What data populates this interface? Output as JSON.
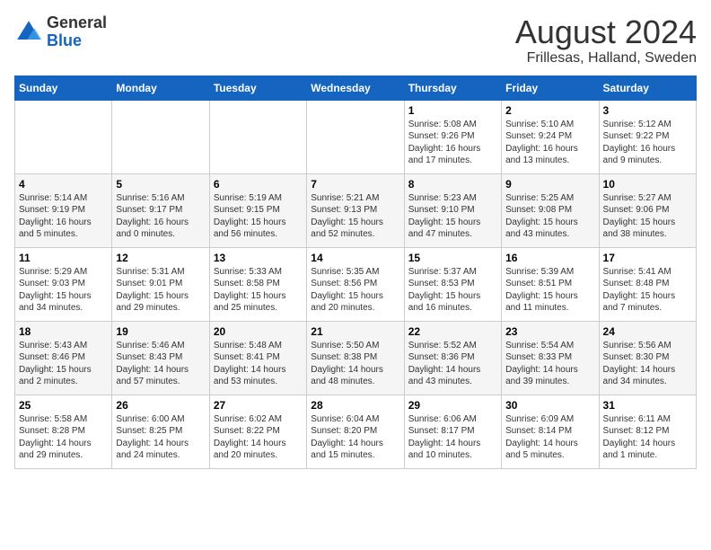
{
  "header": {
    "logo_general": "General",
    "logo_blue": "Blue",
    "month_year": "August 2024",
    "location": "Frillesas, Halland, Sweden"
  },
  "weekdays": [
    "Sunday",
    "Monday",
    "Tuesday",
    "Wednesday",
    "Thursday",
    "Friday",
    "Saturday"
  ],
  "weeks": [
    [
      {
        "day": "",
        "info": ""
      },
      {
        "day": "",
        "info": ""
      },
      {
        "day": "",
        "info": ""
      },
      {
        "day": "",
        "info": ""
      },
      {
        "day": "1",
        "info": "Sunrise: 5:08 AM\nSunset: 9:26 PM\nDaylight: 16 hours\nand 17 minutes."
      },
      {
        "day": "2",
        "info": "Sunrise: 5:10 AM\nSunset: 9:24 PM\nDaylight: 16 hours\nand 13 minutes."
      },
      {
        "day": "3",
        "info": "Sunrise: 5:12 AM\nSunset: 9:22 PM\nDaylight: 16 hours\nand 9 minutes."
      }
    ],
    [
      {
        "day": "4",
        "info": "Sunrise: 5:14 AM\nSunset: 9:19 PM\nDaylight: 16 hours\nand 5 minutes."
      },
      {
        "day": "5",
        "info": "Sunrise: 5:16 AM\nSunset: 9:17 PM\nDaylight: 16 hours\nand 0 minutes."
      },
      {
        "day": "6",
        "info": "Sunrise: 5:19 AM\nSunset: 9:15 PM\nDaylight: 15 hours\nand 56 minutes."
      },
      {
        "day": "7",
        "info": "Sunrise: 5:21 AM\nSunset: 9:13 PM\nDaylight: 15 hours\nand 52 minutes."
      },
      {
        "day": "8",
        "info": "Sunrise: 5:23 AM\nSunset: 9:10 PM\nDaylight: 15 hours\nand 47 minutes."
      },
      {
        "day": "9",
        "info": "Sunrise: 5:25 AM\nSunset: 9:08 PM\nDaylight: 15 hours\nand 43 minutes."
      },
      {
        "day": "10",
        "info": "Sunrise: 5:27 AM\nSunset: 9:06 PM\nDaylight: 15 hours\nand 38 minutes."
      }
    ],
    [
      {
        "day": "11",
        "info": "Sunrise: 5:29 AM\nSunset: 9:03 PM\nDaylight: 15 hours\nand 34 minutes."
      },
      {
        "day": "12",
        "info": "Sunrise: 5:31 AM\nSunset: 9:01 PM\nDaylight: 15 hours\nand 29 minutes."
      },
      {
        "day": "13",
        "info": "Sunrise: 5:33 AM\nSunset: 8:58 PM\nDaylight: 15 hours\nand 25 minutes."
      },
      {
        "day": "14",
        "info": "Sunrise: 5:35 AM\nSunset: 8:56 PM\nDaylight: 15 hours\nand 20 minutes."
      },
      {
        "day": "15",
        "info": "Sunrise: 5:37 AM\nSunset: 8:53 PM\nDaylight: 15 hours\nand 16 minutes."
      },
      {
        "day": "16",
        "info": "Sunrise: 5:39 AM\nSunset: 8:51 PM\nDaylight: 15 hours\nand 11 minutes."
      },
      {
        "day": "17",
        "info": "Sunrise: 5:41 AM\nSunset: 8:48 PM\nDaylight: 15 hours\nand 7 minutes."
      }
    ],
    [
      {
        "day": "18",
        "info": "Sunrise: 5:43 AM\nSunset: 8:46 PM\nDaylight: 15 hours\nand 2 minutes."
      },
      {
        "day": "19",
        "info": "Sunrise: 5:46 AM\nSunset: 8:43 PM\nDaylight: 14 hours\nand 57 minutes."
      },
      {
        "day": "20",
        "info": "Sunrise: 5:48 AM\nSunset: 8:41 PM\nDaylight: 14 hours\nand 53 minutes."
      },
      {
        "day": "21",
        "info": "Sunrise: 5:50 AM\nSunset: 8:38 PM\nDaylight: 14 hours\nand 48 minutes."
      },
      {
        "day": "22",
        "info": "Sunrise: 5:52 AM\nSunset: 8:36 PM\nDaylight: 14 hours\nand 43 minutes."
      },
      {
        "day": "23",
        "info": "Sunrise: 5:54 AM\nSunset: 8:33 PM\nDaylight: 14 hours\nand 39 minutes."
      },
      {
        "day": "24",
        "info": "Sunrise: 5:56 AM\nSunset: 8:30 PM\nDaylight: 14 hours\nand 34 minutes."
      }
    ],
    [
      {
        "day": "25",
        "info": "Sunrise: 5:58 AM\nSunset: 8:28 PM\nDaylight: 14 hours\nand 29 minutes."
      },
      {
        "day": "26",
        "info": "Sunrise: 6:00 AM\nSunset: 8:25 PM\nDaylight: 14 hours\nand 24 minutes."
      },
      {
        "day": "27",
        "info": "Sunrise: 6:02 AM\nSunset: 8:22 PM\nDaylight: 14 hours\nand 20 minutes."
      },
      {
        "day": "28",
        "info": "Sunrise: 6:04 AM\nSunset: 8:20 PM\nDaylight: 14 hours\nand 15 minutes."
      },
      {
        "day": "29",
        "info": "Sunrise: 6:06 AM\nSunset: 8:17 PM\nDaylight: 14 hours\nand 10 minutes."
      },
      {
        "day": "30",
        "info": "Sunrise: 6:09 AM\nSunset: 8:14 PM\nDaylight: 14 hours\nand 5 minutes."
      },
      {
        "day": "31",
        "info": "Sunrise: 6:11 AM\nSunset: 8:12 PM\nDaylight: 14 hours\nand 1 minute."
      }
    ]
  ]
}
